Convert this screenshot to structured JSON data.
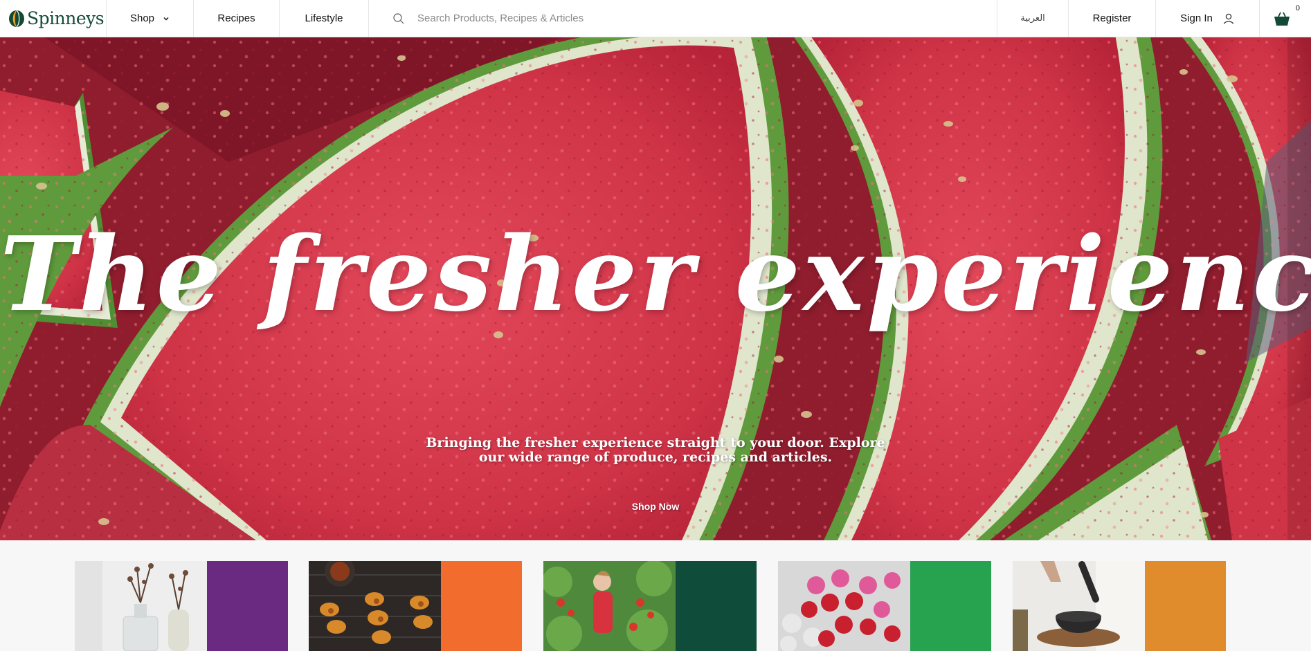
{
  "header": {
    "logo_text": "Spinneys",
    "nav": {
      "shop": "Shop",
      "recipes": "Recipes",
      "lifestyle": "Lifestyle"
    },
    "search": {
      "placeholder": "Search Products, Recipes & Articles"
    },
    "language": "العربية",
    "register": "Register",
    "sign_in": "Sign In",
    "cart_count": "0"
  },
  "hero": {
    "title": "The fresher experience",
    "subtitle": "Bringing the fresher experience straight to your door. Explore our wide range of produce, recipes and articles.",
    "cta": "Shop Now"
  },
  "category_cards": [
    {
      "accent_color": "#6b2a82",
      "image": "home-decor-bottles"
    },
    {
      "accent_color": "#f26c2e",
      "image": "bbq-skewers"
    },
    {
      "accent_color": "#0f4d3a",
      "image": "child-in-garden"
    },
    {
      "accent_color": "#27a24f",
      "image": "rose-bouquet"
    },
    {
      "accent_color": "#e08c2c",
      "image": "mortar-and-pestle"
    }
  ],
  "colors": {
    "brand_green": "#134a36",
    "watermelon_red": "#d93a4f",
    "rind_green": "#5f9b3c"
  }
}
